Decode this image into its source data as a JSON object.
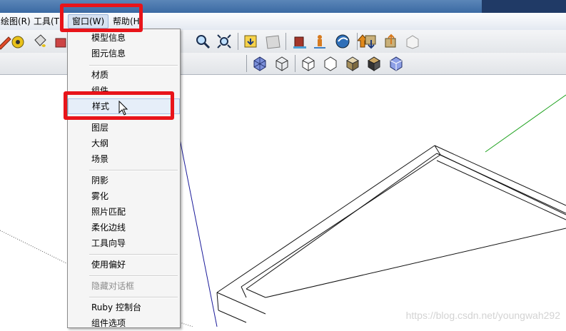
{
  "menubar": {
    "items": [
      {
        "label": "绘图(R)"
      },
      {
        "label": "工具(T"
      },
      {
        "label": "窗口(W)"
      },
      {
        "label": "帮助(H"
      }
    ]
  },
  "window_menu": {
    "groups": [
      [
        {
          "label": "模型信息",
          "disabled": false
        },
        {
          "label": "图元信息",
          "disabled": false
        }
      ],
      [
        {
          "label": "材质",
          "disabled": false
        },
        {
          "label": "组件",
          "disabled": false
        },
        {
          "label": "样式",
          "disabled": false
        },
        {
          "label": "图层",
          "disabled": false
        },
        {
          "label": "大纲",
          "disabled": false
        },
        {
          "label": "场景",
          "disabled": false
        }
      ],
      [
        {
          "label": "阴影",
          "disabled": false
        },
        {
          "label": "雾化",
          "disabled": false
        },
        {
          "label": "照片匹配",
          "disabled": false
        },
        {
          "label": "柔化边线",
          "disabled": false
        },
        {
          "label": "工具向导",
          "disabled": false
        }
      ],
      [
        {
          "label": "使用偏好",
          "disabled": false
        }
      ],
      [
        {
          "label": "隐藏对话框",
          "disabled": true
        }
      ],
      [
        {
          "label": "Ruby 控制台",
          "disabled": false
        },
        {
          "label": "组件选项",
          "disabled": false
        }
      ]
    ],
    "hovered_item": "样式"
  },
  "toolbar_icons": {
    "row1": [
      "pencil-icon",
      "tape-measure-icon",
      "paint-bucket-icon",
      "push-pull-icon",
      "zoom-icon",
      "zoom-extents-icon",
      "get-models-icon",
      "share-model-icon",
      "building-icon",
      "person-icon",
      "google-earth-icon",
      "upload-icon",
      "get-components-icon",
      "share-component-icon",
      "component-outline-icon"
    ],
    "row2": [
      "xray-style-icon",
      "wireframe-style-icon",
      "hidden-line-style-icon",
      "shaded-style-icon",
      "textured-style-icon",
      "monochrome-style-icon",
      "back-edges-style-icon"
    ]
  },
  "watermark": "https://blog.csdn.net/youngwah292",
  "colors": {
    "highlight": "#e8141a",
    "menu_bg": "#f5f5f5",
    "disabled_text": "#8d8d8d"
  }
}
